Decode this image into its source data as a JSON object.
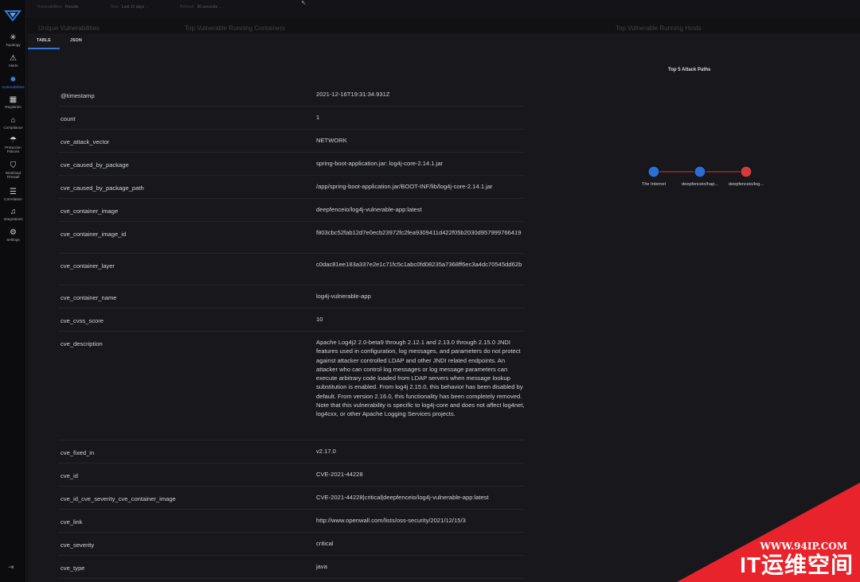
{
  "sidebar": {
    "items": [
      {
        "label": "Topology",
        "icon": "topology-icon"
      },
      {
        "label": "Alerts",
        "icon": "alert-icon"
      },
      {
        "label": "Vulnerabilities",
        "icon": "bug-icon"
      },
      {
        "label": "Registries",
        "icon": "registry-icon"
      },
      {
        "label": "Compliance",
        "icon": "bank-icon"
      },
      {
        "label": "Protection Policies",
        "icon": "umbrella-icon"
      },
      {
        "label": "Workload Firewall",
        "icon": "shield-icon"
      },
      {
        "label": "Correlation",
        "icon": "list-icon"
      },
      {
        "label": "Integrations",
        "icon": "bell-icon"
      },
      {
        "label": "Settings",
        "icon": "gear-icon"
      }
    ],
    "active": "Vulnerabilities",
    "collapse": "⇥"
  },
  "topbar": {
    "items": [
      {
        "label": "Vulnerabilities",
        "value": "Results"
      },
      {
        "label": "Time",
        "value": "Last 15 days"
      },
      {
        "label": "Refresh",
        "value": "30 seconds"
      }
    ]
  },
  "background_headers": [
    "Unique Vulnerabilities",
    "Top Vulnerable Running Containers",
    "Top Vulnerable Running Hosts"
  ],
  "tabs": [
    "TABLE",
    "JSON"
  ],
  "table": {
    "rows": [
      {
        "key": "@timestamp",
        "value": "2021-12-16T19:31:34.931Z"
      },
      {
        "key": "count",
        "value": "1"
      },
      {
        "key": "cve_attack_vector",
        "value": "NETWORK"
      },
      {
        "key": "cve_caused_by_package",
        "value": "spring-boot-application.jar: log4j-core-2.14.1.jar"
      },
      {
        "key": "cve_caused_by_package_path",
        "value": "/app/spring-boot-application.jar/BOOT-INF/lib/log4j-core-2.14.1.jar"
      },
      {
        "key": "cve_container_image",
        "value": "deepfenceio/log4j-vulnerable-app:latest"
      },
      {
        "key": "cve_container_image_id",
        "value": "f803cbc52fab12d7e0ecb23972fc2fea9309411d422f05b2030d957999766419"
      },
      {
        "key": "cve_container_layer",
        "value": "c0dac81ee183a337e2e1c71fc5c1abc0fd08235a7368ff6ec3a4dc70545dd62b"
      },
      {
        "key": "cve_container_name",
        "value": "log4j-vulnerable-app"
      },
      {
        "key": "cve_cvss_score",
        "value": "10"
      },
      {
        "key": "cve_description",
        "value": "Apache Log4j2 2.0-beta9 through 2.12.1 and 2.13.0 through 2.15.0 JNDI features used in configuration, log messages, and parameters do not protect against attacker controlled LDAP and other JNDI related endpoints. An attacker who can control log messages or log message parameters can execute arbitrary code loaded from LDAP servers when message lookup substitution is enabled. From log4j 2.15.0, this behavior has been disabled by default. From version 2.16.0, this functionality has been completely removed. Note that this vulnerability is specific to log4j-core and does not affect log4net, log4cxx, or other Apache Logging Services projects."
      },
      {
        "key": "cve_fixed_in",
        "value": "v2.17.0"
      },
      {
        "key": "cve_id",
        "value": "CVE-2021-44228"
      },
      {
        "key": "cve_id_cve_severity_cve_container_image",
        "value": "CVE-2021-44228|critical|deepfenceio/log4j-vulnerable-app:latest"
      },
      {
        "key": "cve_link",
        "value": "http://www.openwall.com/lists/oss-security/2021/12/15/3"
      },
      {
        "key": "cve_severity",
        "value": "critical"
      },
      {
        "key": "cve_type",
        "value": "java"
      }
    ]
  },
  "attack_paths": {
    "title": "Top 5 Attack Paths",
    "nodes": [
      {
        "label": "The Internet",
        "color": "#2a6fd6"
      },
      {
        "label": "deepfenceio/hap...",
        "color": "#2a6fd6"
      },
      {
        "label": "deepfenceio/log...",
        "color": "#d23b3b"
      }
    ],
    "edge_color": "#c23a3a"
  },
  "watermark": {
    "url": "WWW.94IP.COM",
    "name": "IT运维空间",
    "color": "#e8232b"
  }
}
